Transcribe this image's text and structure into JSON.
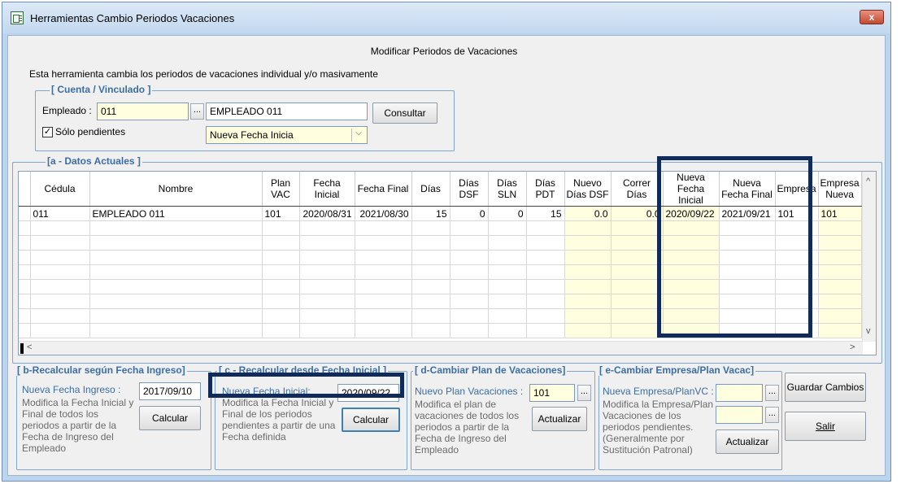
{
  "window": {
    "title": "Herramientas Cambio Periodos Vacaciones",
    "close_label": "x"
  },
  "heading": "Modificar Periodos de Vacaciones",
  "description": "Esta herramienta cambia los periodos de vacaciones individual y/o masivamente",
  "cuenta": {
    "title": "[ Cuenta / Vinculado ]",
    "empleado_label": "Empleado :",
    "empleado_value": "011",
    "lookup_label": "...",
    "empleado_name": "EMPLEADO 011",
    "consultar_label": "Consultar",
    "pendientes_label": "Sólo pendientes",
    "pendientes_checked": true,
    "mode_selected": "Nueva Fecha Inicia"
  },
  "datos": {
    "title": "[a - Datos Actuales ]",
    "columns": [
      "Cédula",
      "Nombre",
      "Plan VAC",
      "Fecha Inicial",
      "Fecha Final",
      "Días",
      "Días DSF",
      "Días SLN",
      "Días PDT",
      "Nuevo Días DSF",
      "Correr Días",
      "Nueva Fecha Inicial",
      "Nueva Fecha Final",
      "Empresa",
      "Empresa Nueva"
    ],
    "rows": [
      [
        "011",
        "EMPLEADO 011",
        "101",
        "2020/08/31",
        "2021/08/30",
        "15",
        "0",
        "0",
        "15",
        "0.0",
        "0.0",
        "2020/09/22",
        "2021/09/21",
        "101",
        "101"
      ]
    ],
    "scroll_left": "<",
    "scroll_right": ">",
    "scroll_up": "^",
    "scroll_down": "v"
  },
  "panel_b": {
    "title": "[ b-Recalcular según Fecha Ingreso]",
    "field_label": "Nueva Fecha Ingreso :",
    "field_value": "2017/09/10",
    "description": "Modifica la Fecha Inicial y Final de todos los periodos a partir de la Fecha de Ingreso del Empleado",
    "button_label": "Calcular"
  },
  "panel_c": {
    "title": "[ c - Recalcular desde Fecha Inicial ]",
    "field_label": "Nueva Fecha Inicial:",
    "field_value": "2020/09/22",
    "description": "Modifica la Fecha Inicial y Final de los periodos pendientes a partir de una Fecha definida",
    "button_label": "Calcular"
  },
  "panel_d": {
    "title": "[ d-Cambiar Plan de Vacaciones]",
    "field_label": "Nuevo Plan Vacaciones :",
    "field_value": "101",
    "lookup_label": "...",
    "description": "Modifica el plan de vacaciones de todos los periodos a partir de la Fecha de Ingreso del Empleado",
    "button_label": "Actualizar"
  },
  "panel_e": {
    "title": "[ e-Cambiar Empresa/Plan Vacac]",
    "field_label": "Nueva Empresa/PlanVC :",
    "lookup_label": "...",
    "description": "Modifica la Empresa/Plan Vacaciones de los periodos pendientes. (Generalmente por Sustitución Patronal)",
    "button_label": "Actualizar"
  },
  "actions": {
    "save_label": "Guardar Cambios",
    "exit_label": "Salir"
  },
  "colors": {
    "highlight": "#102a5a",
    "group_title": "#3b6ea5",
    "yellow_cell": "#ffffe0"
  }
}
